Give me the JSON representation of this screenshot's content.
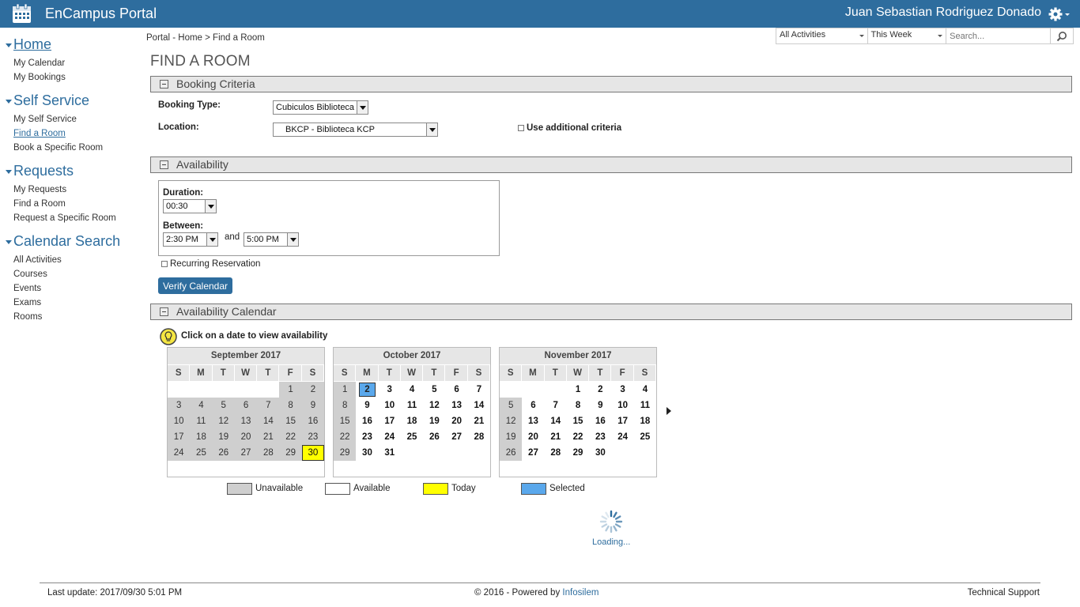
{
  "header": {
    "title": "EnCampus Portal",
    "user": "Juan Sebastian Rodriguez Donado"
  },
  "sidebar": {
    "groups": [
      {
        "label": "Home",
        "items": [
          "My Calendar",
          "My Bookings"
        ]
      },
      {
        "label": "Self Service",
        "items": [
          "My Self Service",
          "Find a Room",
          "Book a Specific Room"
        ]
      },
      {
        "label": "Requests",
        "items": [
          "My Requests",
          "Find a Room",
          "Request a Specific Room"
        ]
      },
      {
        "label": "Calendar Search",
        "items": [
          "All Activities",
          "Courses",
          "Events",
          "Exams",
          "Rooms"
        ]
      }
    ]
  },
  "breadcrumb": {
    "text": "Portal - Home > Find a Room"
  },
  "filters": {
    "activity": "All Activities",
    "period": "This Week",
    "search_placeholder": "Search..."
  },
  "page_title": "FIND A ROOM",
  "sections": {
    "criteria": "Booking Criteria",
    "availability": "Availability",
    "calendar": "Availability Calendar"
  },
  "criteria": {
    "booking_type_label": "Booking Type:",
    "booking_type_value": "Cubiculos Biblioteca",
    "location_label": "Location:",
    "location_value": "BKCP - Biblioteca KCP",
    "additional": "Use additional criteria"
  },
  "availability": {
    "duration_label": "Duration:",
    "duration_value": "00:30",
    "between_label": "Between:",
    "start": "2:30 PM",
    "and": "and",
    "end": "5:00 PM",
    "recurring": "Recurring Reservation",
    "verify": "Verify Calendar"
  },
  "calendar": {
    "hint": "Click on a date to view availability",
    "dow": [
      "S",
      "M",
      "T",
      "W",
      "T",
      "F",
      "S"
    ],
    "months": [
      {
        "title": "September 2017",
        "rows": [
          [
            "",
            "",
            "",
            "",
            "",
            "1",
            "2"
          ],
          [
            "3",
            "4",
            "5",
            "6",
            "7",
            "8",
            "9"
          ],
          [
            "10",
            "11",
            "12",
            "13",
            "14",
            "15",
            "16"
          ],
          [
            "17",
            "18",
            "19",
            "20",
            "21",
            "22",
            "23"
          ],
          [
            "24",
            "25",
            "26",
            "27",
            "28",
            "29",
            "30"
          ]
        ]
      },
      {
        "title": "October 2017",
        "rows": [
          [
            "1",
            "2",
            "3",
            "4",
            "5",
            "6",
            "7"
          ],
          [
            "8",
            "9",
            "10",
            "11",
            "12",
            "13",
            "14"
          ],
          [
            "15",
            "16",
            "17",
            "18",
            "19",
            "20",
            "21"
          ],
          [
            "22",
            "23",
            "24",
            "25",
            "26",
            "27",
            "28"
          ],
          [
            "29",
            "30",
            "31",
            "",
            "",
            "",
            ""
          ]
        ]
      },
      {
        "title": "November 2017",
        "rows": [
          [
            "",
            "",
            "",
            "1",
            "2",
            "3",
            "4"
          ],
          [
            "5",
            "6",
            "7",
            "8",
            "9",
            "10",
            "11"
          ],
          [
            "12",
            "13",
            "14",
            "15",
            "16",
            "17",
            "18"
          ],
          [
            "19",
            "20",
            "21",
            "22",
            "23",
            "24",
            "25"
          ],
          [
            "26",
            "27",
            "28",
            "29",
            "30",
            "",
            ""
          ]
        ]
      }
    ],
    "today": "2017-09-30",
    "selected": "2017-10-02",
    "legend": [
      "Unavailable",
      "Available",
      "Today",
      "Selected"
    ],
    "colors": {
      "unavailable": "#cfcfcf",
      "available": "#ffffff",
      "today": "#ffff00",
      "selected": "#5aa8ec"
    },
    "loading": "Loading..."
  },
  "footer": {
    "last_update": "Last update: 2017/09/30 5:01 PM",
    "powered": "© 2016 - Powered by ",
    "powered_link": "Infosilem",
    "support": "Technical Support"
  }
}
